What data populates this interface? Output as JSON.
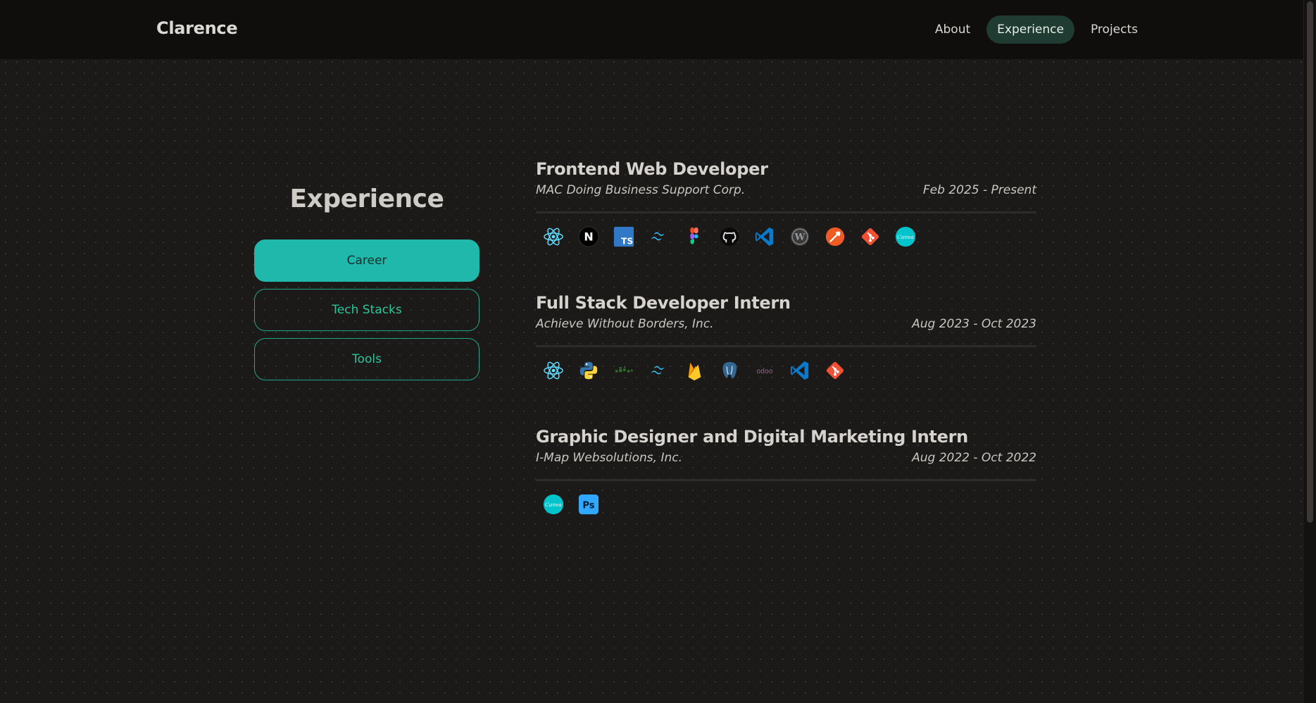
{
  "header": {
    "brand": "Clarence",
    "nav": [
      {
        "label": "About"
      },
      {
        "label": "Experience",
        "active": true
      },
      {
        "label": "Projects"
      }
    ]
  },
  "sidebar": {
    "title": "Experience",
    "tabs": [
      {
        "label": "Career",
        "active": true
      },
      {
        "label": "Tech Stacks"
      },
      {
        "label": "Tools"
      }
    ]
  },
  "jobs": [
    {
      "title": "Frontend Web Developer",
      "company": "MAC Doing Business Support Corp.",
      "period": "Feb 2025 - Present",
      "icons": [
        "react-icon",
        "nextjs-icon",
        "typescript-icon",
        "tailwind-icon",
        "figma-icon",
        "github-icon",
        "vscode-icon",
        "wordpress-icon",
        "postman-icon",
        "git-icon",
        "canva-icon"
      ]
    },
    {
      "title": "Full Stack Developer Intern",
      "company": "Achieve Without Borders, Inc.",
      "period": "Aug 2023 - Oct 2023",
      "icons": [
        "react-icon",
        "python-icon",
        "nodejs-icon",
        "tailwind-icon",
        "firebase-icon",
        "postgresql-icon",
        "odoo-icon",
        "vscode-icon",
        "git-icon"
      ]
    },
    {
      "title": "Graphic Designer and Digital Marketing Intern",
      "company": "I-Map Websolutions, Inc.",
      "period": "Aug 2022 - Oct 2022",
      "icons": [
        "canva-icon",
        "photoshop-icon"
      ]
    }
  ],
  "icon_labels": {
    "nextjs": "N",
    "typescript": "TS",
    "canva": "Canva",
    "odoo": "odoo",
    "photoshop": "Ps",
    "wordpress": "W"
  },
  "colors": {
    "accent": "#20b8aa",
    "nav_active_bg": "#1f3b32",
    "tab_border": "#1fa687",
    "background": "#1c1a19",
    "topbar": "#100e0d"
  }
}
